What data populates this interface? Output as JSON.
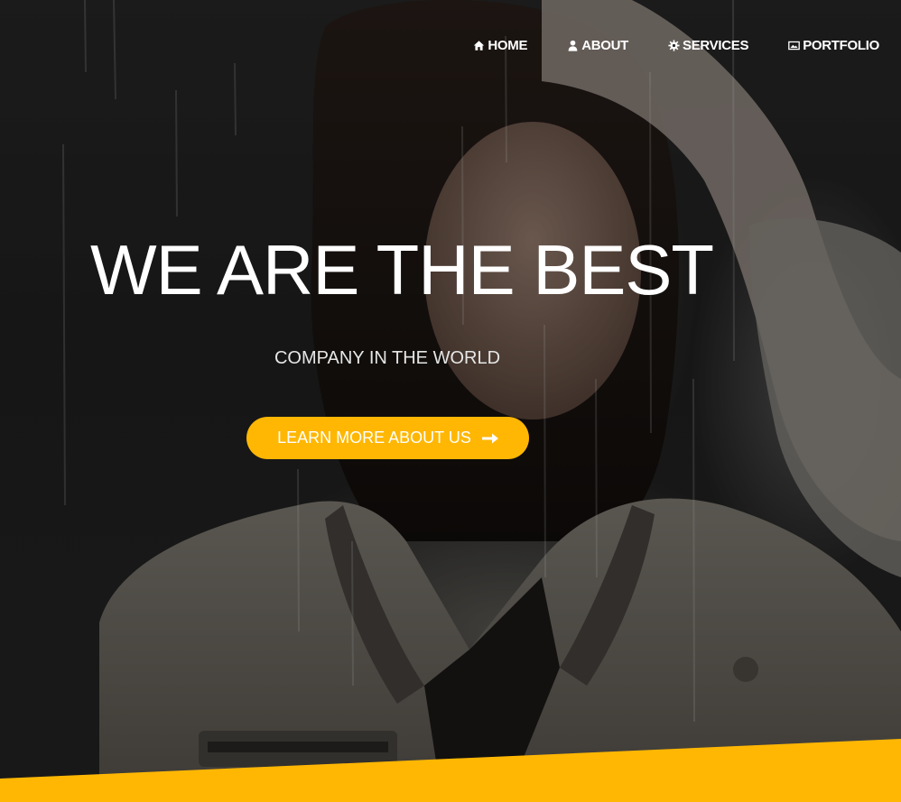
{
  "nav": {
    "items": [
      {
        "label": "HOME",
        "icon": "home-icon"
      },
      {
        "label": "ABOUT",
        "icon": "user-icon"
      },
      {
        "label": "SERVICES",
        "icon": "gear-icon"
      },
      {
        "label": "PORTFOLIO",
        "icon": "image-icon"
      }
    ]
  },
  "hero": {
    "headline": "WE ARE THE BEST",
    "subline": "COMPANY IN THE WORLD",
    "cta_label": "LEARN MORE ABOUT US",
    "cta_icon": "arrow-right-icon"
  },
  "colors": {
    "accent": "#ffb703",
    "text": "#ffffff",
    "overlay": "#000000"
  }
}
